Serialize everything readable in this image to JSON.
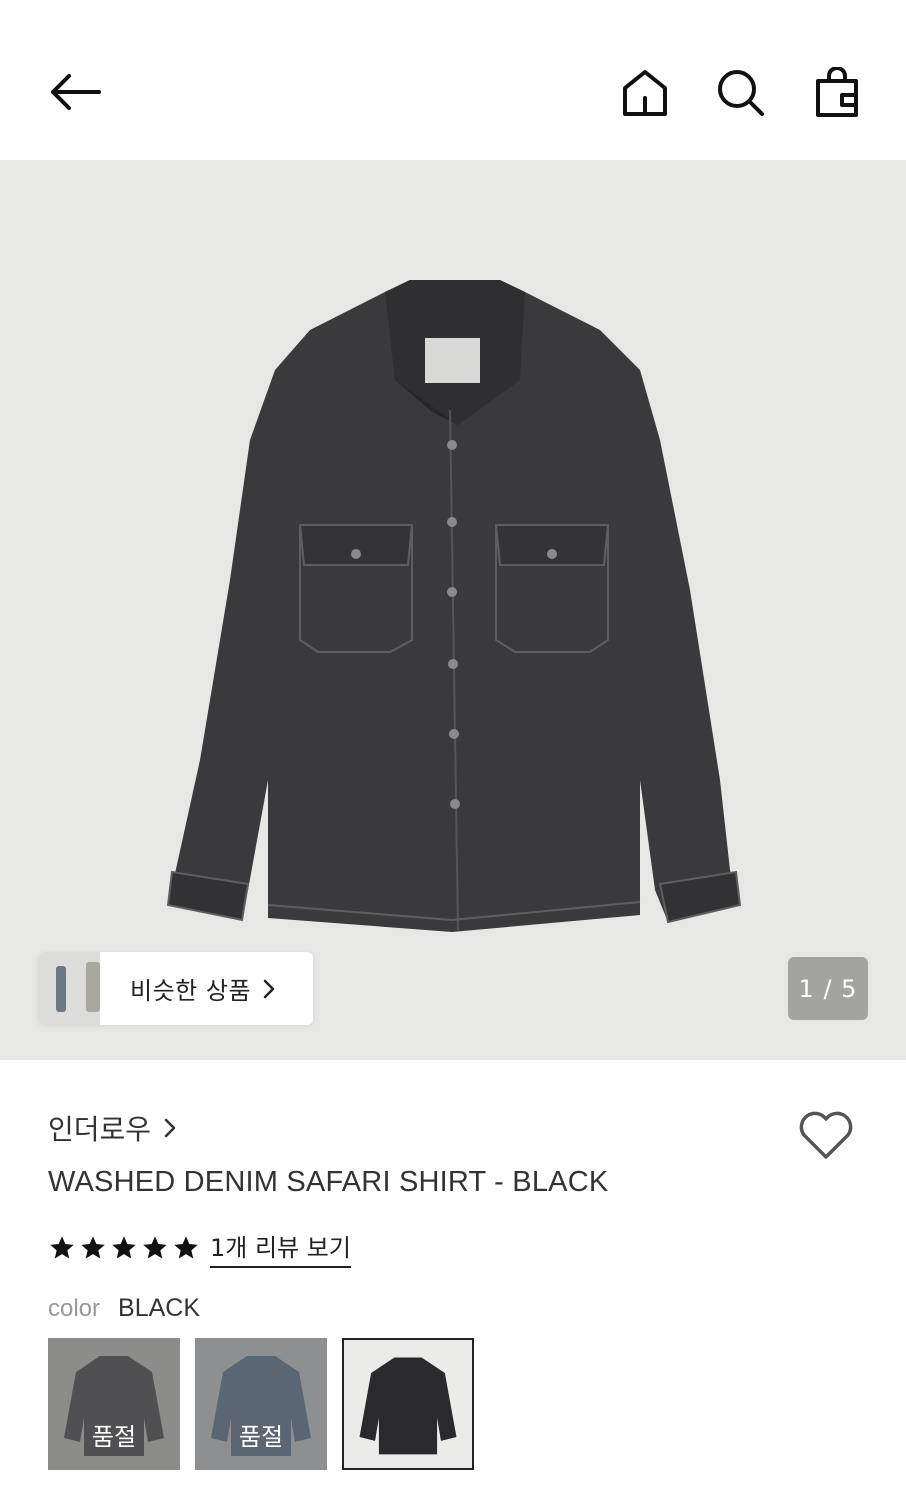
{
  "header": {
    "back_icon": "arrow-left-icon",
    "home_icon": "home-icon",
    "search_icon": "search-icon",
    "bag_icon": "shopping-bag-icon"
  },
  "gallery": {
    "similar_label": "비슷한 상품",
    "pager": "1 / 5",
    "image_bg": "#e7e7e5"
  },
  "product": {
    "brand": "인더로우",
    "title": "WASHED DENIM SAFARI SHIRT - BLACK",
    "rating_stars": 5,
    "review_link": "1개 리뷰 보기",
    "color_label": "color",
    "color_value": "BLACK"
  },
  "swatches": [
    {
      "status": "품절"
    },
    {
      "status": "품절"
    },
    {
      "status": ""
    }
  ],
  "colors": {
    "shirt_dark": "#3a3a3c",
    "shirt_blue": "#4a5868",
    "soldout_overlay": "#8c8c8a"
  }
}
